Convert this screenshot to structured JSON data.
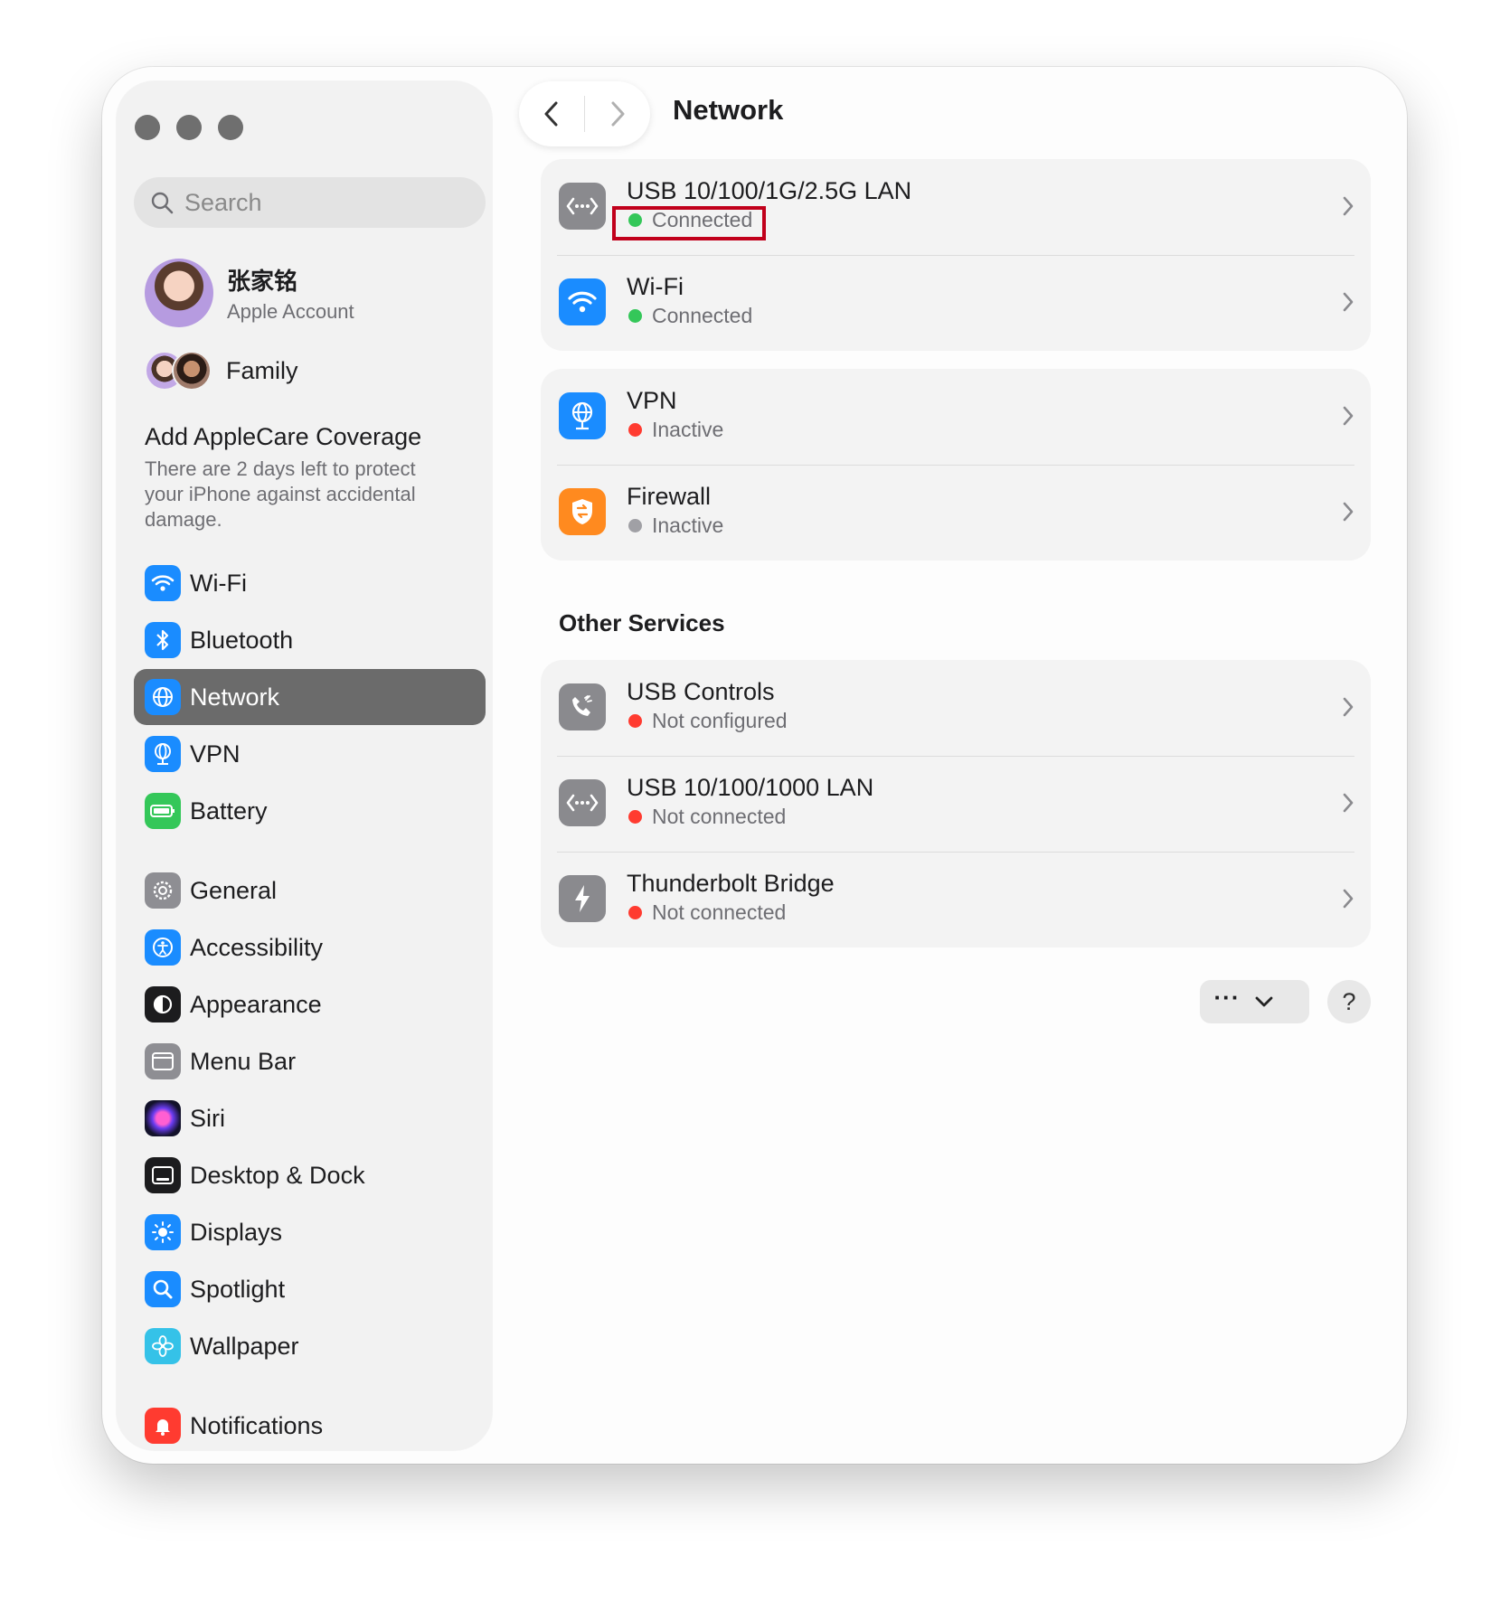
{
  "window": {
    "search_placeholder": "Search",
    "page_title": "Network"
  },
  "account": {
    "name": "张家铭",
    "subtitle": "Apple Account"
  },
  "family": {
    "label": "Family"
  },
  "applecare": {
    "title": "Add AppleCare Coverage",
    "description": "There are 2 days left to protect your iPhone against accidental damage."
  },
  "sidebar": {
    "items": [
      {
        "label": "Wi-Fi",
        "icon": "wifi-icon",
        "color": "#1a8cff"
      },
      {
        "label": "Bluetooth",
        "icon": "bluetooth-icon",
        "color": "#1a8cff"
      },
      {
        "label": "Network",
        "icon": "globe-icon",
        "color": "#1a8cff",
        "selected": true
      },
      {
        "label": "VPN",
        "icon": "vpn-globe-icon",
        "color": "#1a8cff"
      },
      {
        "label": "Battery",
        "icon": "battery-icon",
        "color": "#34c759"
      },
      {
        "label": "General",
        "icon": "gear-icon",
        "color": "#8e8e93"
      },
      {
        "label": "Accessibility",
        "icon": "accessibility-icon",
        "color": "#1a8cff"
      },
      {
        "label": "Appearance",
        "icon": "appearance-icon",
        "color": "#1c1c1e"
      },
      {
        "label": "Menu Bar",
        "icon": "menubar-icon",
        "color": "#8e8e93"
      },
      {
        "label": "Siri",
        "icon": "siri-icon",
        "color": "#5b2ca0"
      },
      {
        "label": "Desktop & Dock",
        "icon": "dock-icon",
        "color": "#1c1c1e"
      },
      {
        "label": "Displays",
        "icon": "displays-icon",
        "color": "#1a8cff"
      },
      {
        "label": "Spotlight",
        "icon": "spotlight-icon",
        "color": "#1a8cff"
      },
      {
        "label": "Wallpaper",
        "icon": "wallpaper-icon",
        "color": "#35c2e8"
      },
      {
        "label": "Notifications",
        "icon": "notifications-icon",
        "color": "#ff3b30"
      }
    ]
  },
  "services": [
    {
      "name": "USB 10/100/1G/2.5G LAN",
      "status": "Connected",
      "status_color": "#34c759",
      "icon": "ethernet-icon"
    },
    {
      "name": "Wi-Fi",
      "status": "Connected",
      "status_color": "#34c759",
      "icon": "wifi-icon"
    }
  ],
  "security": [
    {
      "name": "VPN",
      "status": "Inactive",
      "status_color": "#ff3b30",
      "icon": "vpn-globe-icon"
    },
    {
      "name": "Firewall",
      "status": "Inactive",
      "status_color": "#a0a0a5",
      "icon": "firewall-shield-icon"
    }
  ],
  "other_services": {
    "title": "Other Services",
    "items": [
      {
        "name": "USB Controls",
        "status": "Not configured",
        "status_color": "#ff3b30",
        "icon": "phone-icon"
      },
      {
        "name": "USB 10/100/1000 LAN",
        "status": "Not connected",
        "status_color": "#ff3b30",
        "icon": "ethernet-icon"
      },
      {
        "name": "Thunderbolt Bridge",
        "status": "Not connected",
        "status_color": "#ff3b30",
        "icon": "thunderbolt-icon"
      }
    ]
  },
  "actions": {
    "more_label": "···",
    "help_label": "?"
  }
}
